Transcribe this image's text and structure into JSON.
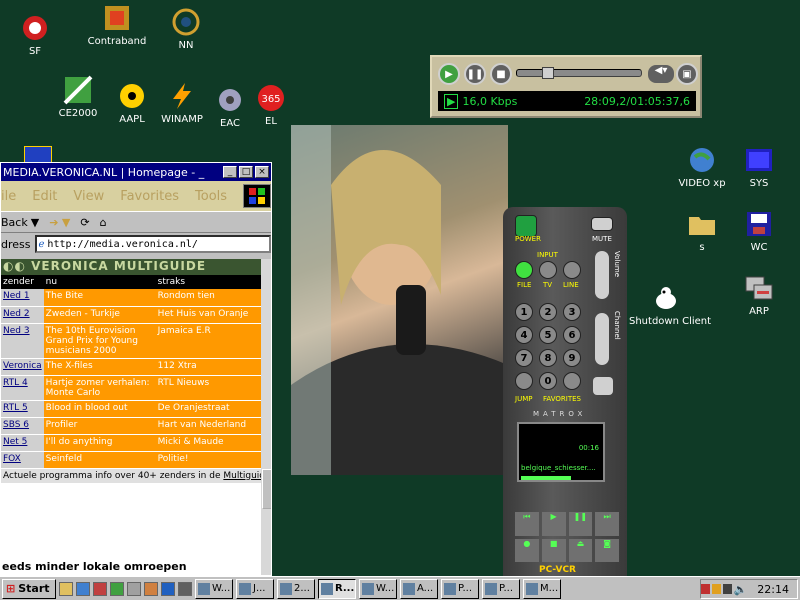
{
  "desktop_icons": [
    {
      "label": "SF",
      "icon": "sf-icon",
      "color": "#d02020"
    },
    {
      "label": "Contraband",
      "icon": "contraband-icon",
      "color": "#c09020"
    },
    {
      "label": "NN",
      "icon": "nn-icon",
      "color": "#205080"
    },
    {
      "label": "CE2000",
      "icon": "ce2000-icon",
      "color": "#40a040"
    },
    {
      "label": "AAPL",
      "icon": "aapl-icon",
      "color": "#ffd000"
    },
    {
      "label": "WINAMP",
      "icon": "winamp-icon",
      "color": "#ffa000"
    },
    {
      "label": "EAC",
      "icon": "eac-icon",
      "color": "#404040"
    },
    {
      "label": "EL",
      "icon": "el-icon",
      "color": "#e02020"
    },
    {
      "label": "VIDEO xp",
      "icon": "video-xp-icon",
      "color": "#4080d0"
    },
    {
      "label": "SYS",
      "icon": "sys-icon",
      "color": "#2020c0"
    },
    {
      "label": "s",
      "icon": "folder-icon",
      "color": "#e0c060"
    },
    {
      "label": "WC",
      "icon": "wc-icon",
      "color": "#c04040"
    },
    {
      "label": "Shutdown Client",
      "icon": "shutdown-client-icon",
      "color": "#ffffff"
    },
    {
      "label": "ARP",
      "icon": "arp-icon",
      "color": "#d04040"
    }
  ],
  "browser": {
    "title": "MEDIA.VERONICA.NL | Homepage - _",
    "menu": [
      "ile",
      "Edit",
      "View",
      "Favorites",
      "Tools"
    ],
    "toolbar": {
      "back": "Back"
    },
    "address_label": "dress",
    "address": "http://media.veronica.nl/",
    "banner": "VERONICA MULTIGUIDE",
    "table_headers": [
      "zender",
      "nu",
      "straks"
    ],
    "rows": [
      {
        "zender": "Ned 1",
        "nu": "The Bite",
        "straks": "Rondom tien"
      },
      {
        "zender": "Ned 2",
        "nu": "Zweden - Turkije",
        "straks": "Het Huis van Oranje"
      },
      {
        "zender": "Ned 3",
        "nu": "The 10th Eurovision Grand Prix for Young musicians 2000",
        "straks": "Jamaica E.R"
      },
      {
        "zender": "Veronica",
        "nu": "The X-files",
        "straks": "112 Xtra"
      },
      {
        "zender": "RTL 4",
        "nu": "Hartje zomer verhalen: Monte Carlo",
        "straks": "RTL Nieuws"
      },
      {
        "zender": "RTL 5",
        "nu": "Blood in blood out",
        "straks": "De Oranjestraat"
      },
      {
        "zender": "SBS 6",
        "nu": "Profiler",
        "straks": "Hart van Nederland"
      },
      {
        "zender": "Net 5",
        "nu": "I'll do anything",
        "straks": "Micki & Maude"
      },
      {
        "zender": "FOX",
        "nu": "Seinfeld",
        "straks": "Politie!"
      }
    ],
    "info_text": "Actuele programma info over 40+ zenders in de",
    "info_link": "Multiguide",
    "bottom_text": "eeds minder lokale omroepen"
  },
  "player": {
    "bitrate": "16,0 Kbps",
    "time": "28:09,2/01:05:37,6",
    "progress": 0.2
  },
  "remote": {
    "power": "POWER",
    "mute": "MUTE",
    "input": "INPUT",
    "file": "FILE",
    "tv": "TV",
    "line": "LINE",
    "volume": "Volume",
    "channel": "Channel",
    "keys": [
      "1",
      "2",
      "3",
      "4",
      "5",
      "6",
      "7",
      "8",
      "9",
      "0"
    ],
    "jump": "JUMP",
    "favorites": "FAVORITES",
    "brand": "MATROX",
    "screen_time": "00:16",
    "screen_file": "belgique_schiesser....",
    "pcvcr": "PC-VCR"
  },
  "taskbar": {
    "start": "Start",
    "tasks": [
      "W...",
      "J...",
      "2...",
      "R...",
      "W...",
      "A...",
      "P...",
      "P...",
      "M..."
    ],
    "active_index": 3,
    "clock": "22:14"
  }
}
